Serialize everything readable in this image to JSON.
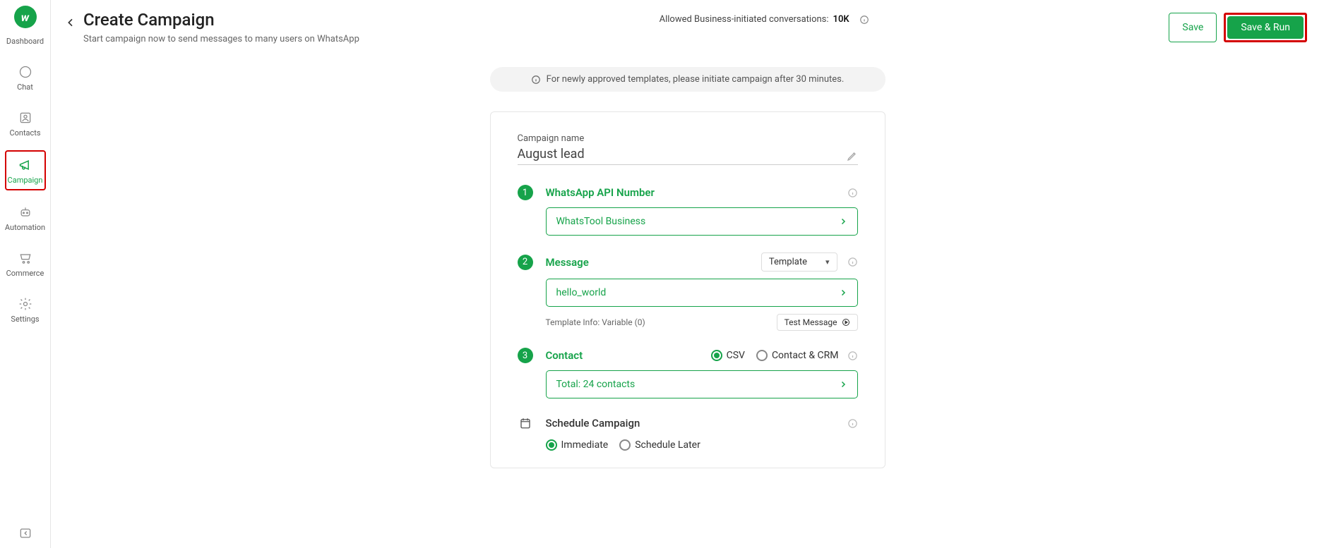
{
  "sidebar": {
    "items": [
      {
        "label": "Dashboard"
      },
      {
        "label": "Chat"
      },
      {
        "label": "Contacts"
      },
      {
        "label": "Campaign"
      },
      {
        "label": "Automation"
      },
      {
        "label": "Commerce"
      },
      {
        "label": "Settings"
      }
    ]
  },
  "header": {
    "title": "Create Campaign",
    "subtitle": "Start campaign now to send messages to many users on WhatsApp",
    "allowed_prefix": "Allowed Business-initiated conversations:",
    "allowed_count": "10K",
    "save_label": "Save",
    "save_run_label": "Save & Run"
  },
  "banner": {
    "text": "For newly approved templates, please initiate campaign after 30 minutes."
  },
  "form": {
    "name_label": "Campaign name",
    "name_value": "August lead",
    "step1": {
      "num": "1",
      "title": "WhatsApp API Number",
      "value": "WhatsTool Business"
    },
    "step2": {
      "num": "2",
      "title": "Message",
      "type_dropdown": "Template",
      "value": "hello_world",
      "template_info": "Template Info: Variable (0)",
      "test_label": "Test Message"
    },
    "step3": {
      "num": "3",
      "title": "Contact",
      "option_csv": "CSV",
      "option_crm": "Contact & CRM",
      "value": "Total: 24 contacts"
    },
    "schedule": {
      "title": "Schedule Campaign",
      "option_immediate": "Immediate",
      "option_later": "Schedule Later"
    }
  }
}
